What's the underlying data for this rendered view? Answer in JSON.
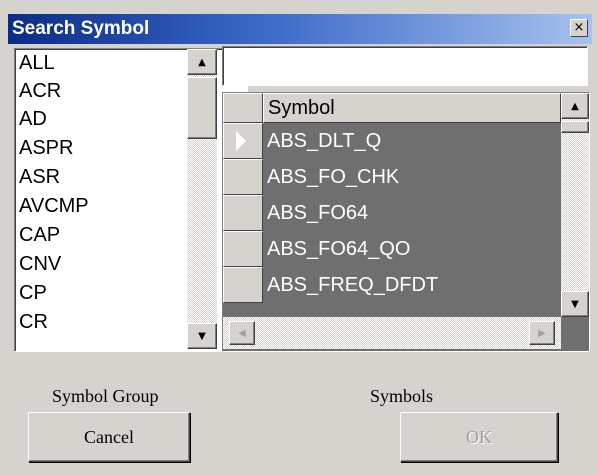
{
  "window": {
    "title": "Search Symbol",
    "close_glyph": "×"
  },
  "symbol_group": {
    "label": "Symbol Group",
    "items": [
      "ALL",
      "ACR",
      "AD",
      "ASPR",
      "ASR",
      "AVCMP",
      "CAP",
      "CNV",
      "CP",
      "CR"
    ]
  },
  "search": {
    "value": ""
  },
  "symbols_grid": {
    "column_header": "Symbol",
    "rows": [
      "ABS_DLT_Q",
      "ABS_FO_CHK",
      "ABS_FO64",
      "ABS_FO64_QO",
      "ABS_FREQ_DFDT"
    ],
    "selected_row": 0
  },
  "footer": {
    "symbols_label": "Symbols",
    "cancel_label": "Cancel",
    "ok_label": "OK"
  },
  "colors": {
    "title_bar_start": "#0a2b86",
    "grid_background": "#6f6f6f",
    "window_background": "#d6d3ce"
  },
  "icons": {
    "scroll_up": "scroll-up-arrow-icon",
    "scroll_down": "scroll-down-arrow-icon",
    "scroll_left": "scroll-left-arrow-icon",
    "scroll_right": "scroll-right-arrow-icon",
    "row_pointer": "row-pointer-icon",
    "close": "close-icon"
  }
}
